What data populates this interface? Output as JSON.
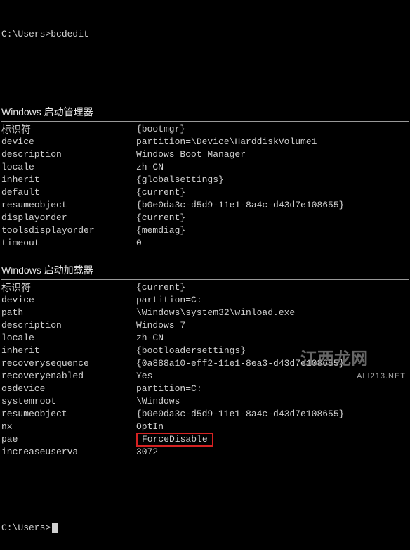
{
  "prompt": "C:\\Users>",
  "command": "bcdedit",
  "sections": [
    {
      "title": "Windows 启动管理器",
      "rows": [
        {
          "key": "标识符",
          "cn": true,
          "val": "{bootmgr}"
        },
        {
          "key": "device",
          "cn": false,
          "val": "partition=\\Device\\HarddiskVolume1"
        },
        {
          "key": "description",
          "cn": false,
          "val": "Windows Boot Manager"
        },
        {
          "key": "locale",
          "cn": false,
          "val": "zh-CN"
        },
        {
          "key": "inherit",
          "cn": false,
          "val": "{globalsettings}"
        },
        {
          "key": "default",
          "cn": false,
          "val": "{current}"
        },
        {
          "key": "resumeobject",
          "cn": false,
          "val": "{b0e0da3c-d5d9-11e1-8a4c-d43d7e108655}"
        },
        {
          "key": "displayorder",
          "cn": false,
          "val": "{current}"
        },
        {
          "key": "toolsdisplayorder",
          "cn": false,
          "val": "{memdiag}"
        },
        {
          "key": "timeout",
          "cn": false,
          "val": "0"
        }
      ]
    },
    {
      "title": "Windows 启动加载器",
      "rows": [
        {
          "key": "标识符",
          "cn": true,
          "val": "{current}"
        },
        {
          "key": "device",
          "cn": false,
          "val": "partition=C:"
        },
        {
          "key": "path",
          "cn": false,
          "val": "\\Windows\\system32\\winload.exe"
        },
        {
          "key": "description",
          "cn": false,
          "val": "Windows 7"
        },
        {
          "key": "locale",
          "cn": false,
          "val": "zh-CN"
        },
        {
          "key": "inherit",
          "cn": false,
          "val": "{bootloadersettings}"
        },
        {
          "key": "recoverysequence",
          "cn": false,
          "val": "{0a888a10-eff2-11e1-8ea3-d43d7e108655}"
        },
        {
          "key": "recoveryenabled",
          "cn": false,
          "val": "Yes"
        },
        {
          "key": "osdevice",
          "cn": false,
          "val": "partition=C:"
        },
        {
          "key": "systemroot",
          "cn": false,
          "val": "\\Windows"
        },
        {
          "key": "resumeobject",
          "cn": false,
          "val": "{b0e0da3c-d5d9-11e1-8a4c-d43d7e108655}"
        },
        {
          "key": "nx",
          "cn": false,
          "val": "OptIn"
        },
        {
          "key": "pae",
          "cn": false,
          "val": "ForceDisable",
          "highlight": true
        },
        {
          "key": "increaseuserva",
          "cn": false,
          "val": "3072"
        }
      ]
    }
  ],
  "final_prompt": "C:\\Users>",
  "watermark1": "江西龙网",
  "watermark2": "ALI213.NET"
}
